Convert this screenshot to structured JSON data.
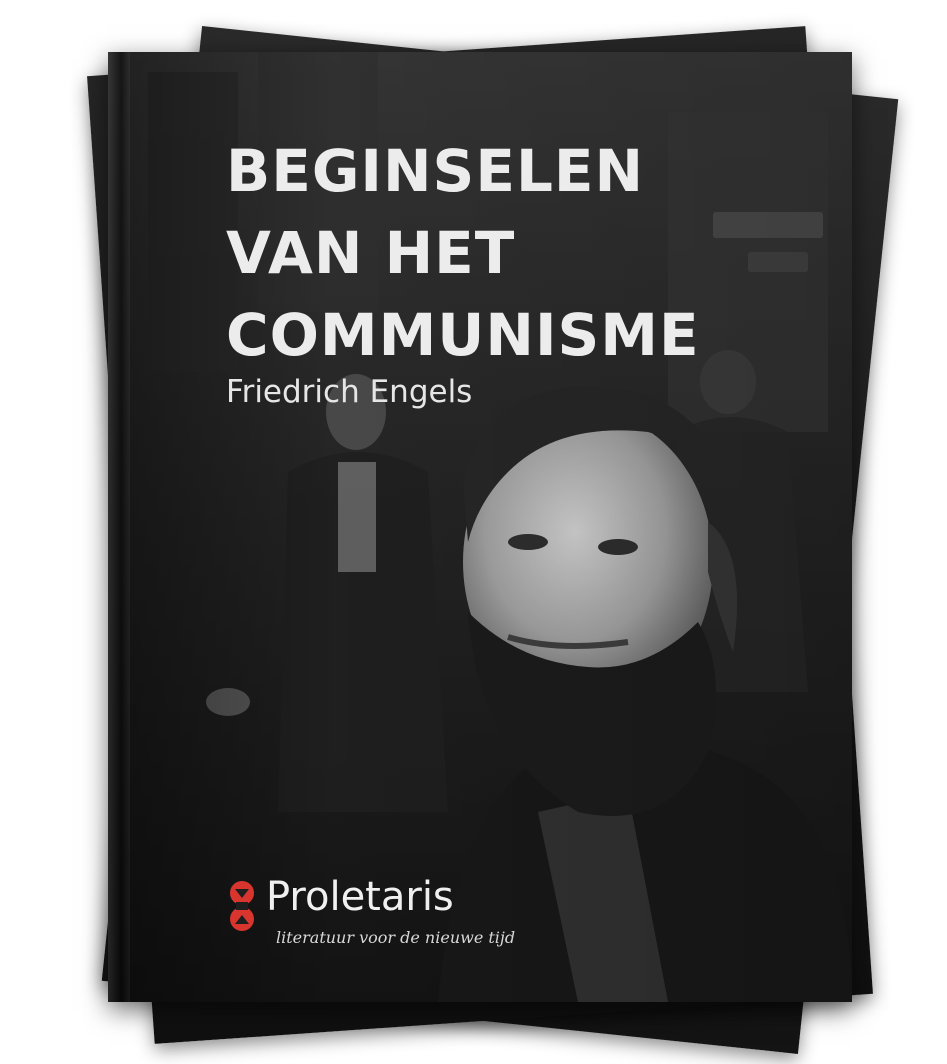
{
  "book": {
    "title_lines": [
      "BEGINSELEN",
      "VAN HET",
      "COMMUNISME"
    ],
    "author": "Friedrich Engels",
    "publisher_name": "Proletaris",
    "publisher_tagline": "literatuur voor de nieuwe tijd"
  },
  "colors": {
    "cover_dark": "#1e1e1e",
    "title_text": "#ececec",
    "logo_red": "#d9352f"
  },
  "icons": {
    "publisher_logo": "proletaris-logo",
    "cover_photo": "portrait-photo"
  }
}
